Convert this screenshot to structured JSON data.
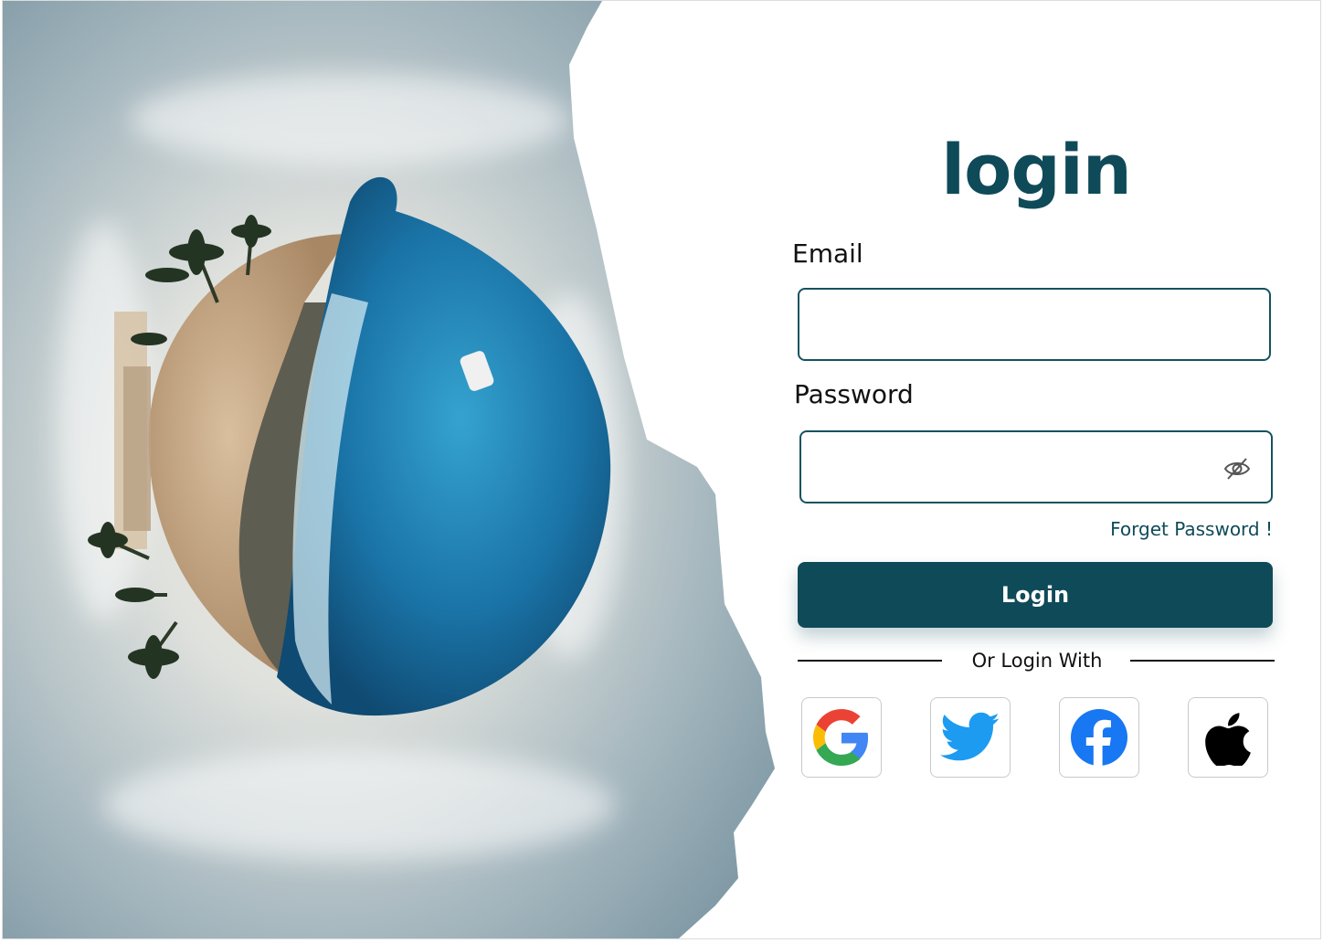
{
  "login": {
    "title": "login",
    "email_label": "Email",
    "email_value": "",
    "password_label": "Password",
    "password_value": "",
    "forgot_password": "Forget Password !",
    "login_button": "Login",
    "divider_text": "Or Login With",
    "social": [
      {
        "name": "google",
        "icon": "google-icon"
      },
      {
        "name": "twitter",
        "icon": "twitter-icon"
      },
      {
        "name": "facebook",
        "icon": "facebook-icon"
      },
      {
        "name": "apple",
        "icon": "apple-icon"
      }
    ]
  },
  "colors": {
    "primary": "#0f4a59",
    "field_border": "#155261",
    "sky": "#7f9aa6",
    "ocean": "#1f7fb0",
    "sand": "#c9ab88"
  }
}
